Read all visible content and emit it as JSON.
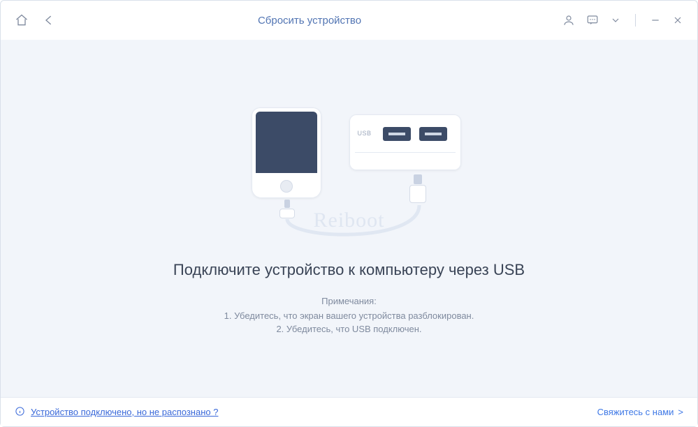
{
  "header": {
    "title": "Сбросить устройство"
  },
  "main": {
    "watermark": "Reiboot",
    "heading": "Подключите устройство к компьютеру через USB",
    "notes_label": "Примечания:",
    "note1": "1. Убедитесь, что экран вашего устройства разблокирован.",
    "note2": "2. Убедитесь, что USB подключен.",
    "hub_label": "USB"
  },
  "footer": {
    "help_link": "Устройство подключено, но не распознано ?",
    "contact": "Свяжитесь с нами",
    "contact_arrow": ">"
  }
}
